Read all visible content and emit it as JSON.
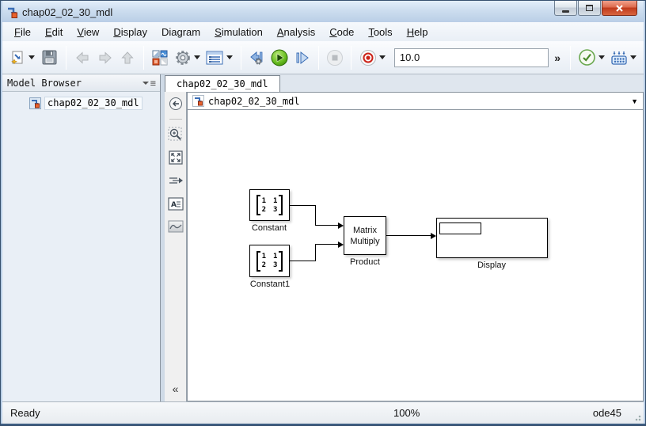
{
  "window": {
    "title": "chap02_02_30_mdl"
  },
  "menu": {
    "items": [
      {
        "pre": "",
        "key": "F",
        "post": "ile"
      },
      {
        "pre": "",
        "key": "E",
        "post": "dit"
      },
      {
        "pre": "",
        "key": "V",
        "post": "iew"
      },
      {
        "pre": "",
        "key": "D",
        "post": "isplay"
      },
      {
        "pre": "Dia",
        "key": "g",
        "post": "ram"
      },
      {
        "pre": "",
        "key": "S",
        "post": "imulation"
      },
      {
        "pre": "",
        "key": "A",
        "post": "nalysis"
      },
      {
        "pre": "",
        "key": "C",
        "post": "ode"
      },
      {
        "pre": "",
        "key": "T",
        "post": "ools"
      },
      {
        "pre": "",
        "key": "H",
        "post": "elp"
      }
    ]
  },
  "toolbar": {
    "sim_time": "10.0",
    "overflow": "»"
  },
  "model_browser": {
    "header": "Model Browser",
    "item": "chap02_02_30_mdl"
  },
  "tab": {
    "label": "chap02_02_30_mdl"
  },
  "breadcrumb": {
    "label": "chap02_02_30_mdl",
    "dropdown": "▼"
  },
  "palette": {
    "collapse": "«"
  },
  "canvas": {
    "blocks": {
      "constant": {
        "label": "Constant",
        "matrix": [
          [
            "1",
            "1"
          ],
          [
            "2",
            "3"
          ]
        ]
      },
      "constant1": {
        "label": "Constant1",
        "matrix": [
          [
            "1",
            "1"
          ],
          [
            "2",
            "3"
          ]
        ]
      },
      "product": {
        "text_line1": "Matrix",
        "text_line2": "Multiply",
        "label": "Product"
      },
      "display": {
        "label": "Display",
        "value": ""
      }
    }
  },
  "statusbar": {
    "state": "Ready",
    "zoom": "100%",
    "solver": "ode45"
  },
  "colors": {
    "accent_blue": "#3a6db5",
    "run_green": "#55a515",
    "record_red": "#cc2218",
    "library_orange": "#e05a2b",
    "close_red": "#c03a1c",
    "titlebar_blue": "#cfdff0"
  }
}
